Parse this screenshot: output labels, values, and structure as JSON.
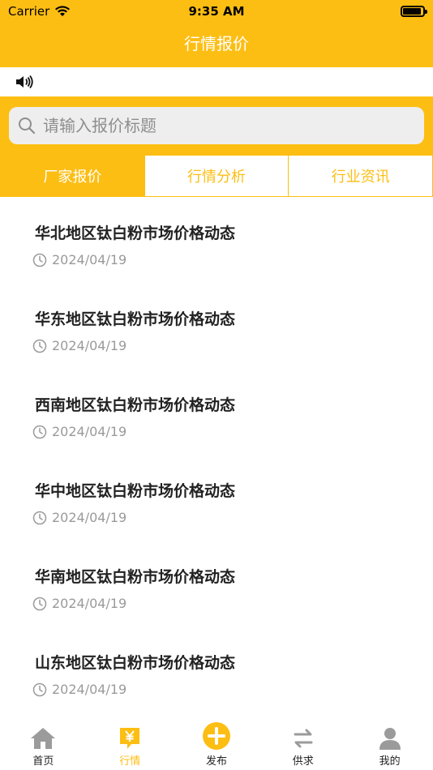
{
  "status": {
    "carrier": "Carrier",
    "time": "9:35 AM"
  },
  "nav": {
    "title": "行情报价"
  },
  "search": {
    "placeholder": "请输入报价标题"
  },
  "tabs": [
    {
      "label": "厂家报价",
      "active": true
    },
    {
      "label": "行情分析",
      "active": false
    },
    {
      "label": "行业资讯",
      "active": false
    }
  ],
  "items": [
    {
      "title": "华北地区钛白粉市场价格动态",
      "date": "2024/04/19"
    },
    {
      "title": "华东地区钛白粉市场价格动态",
      "date": "2024/04/19"
    },
    {
      "title": "西南地区钛白粉市场价格动态",
      "date": "2024/04/19"
    },
    {
      "title": "华中地区钛白粉市场价格动态",
      "date": "2024/04/19"
    },
    {
      "title": "华南地区钛白粉市场价格动态",
      "date": "2024/04/19"
    },
    {
      "title": "山东地区钛白粉市场价格动态",
      "date": "2024/04/19"
    }
  ],
  "tabbar": [
    {
      "label": "首页",
      "icon": "home-icon"
    },
    {
      "label": "行情",
      "icon": "market-icon",
      "active": true
    },
    {
      "label": "发布",
      "icon": "plus-icon"
    },
    {
      "label": "供求",
      "icon": "exchange-icon"
    },
    {
      "label": "我的",
      "icon": "profile-icon"
    }
  ],
  "colors": {
    "accent": "#FDBE13",
    "text": "#222222",
    "muted": "#9a9a9a"
  }
}
